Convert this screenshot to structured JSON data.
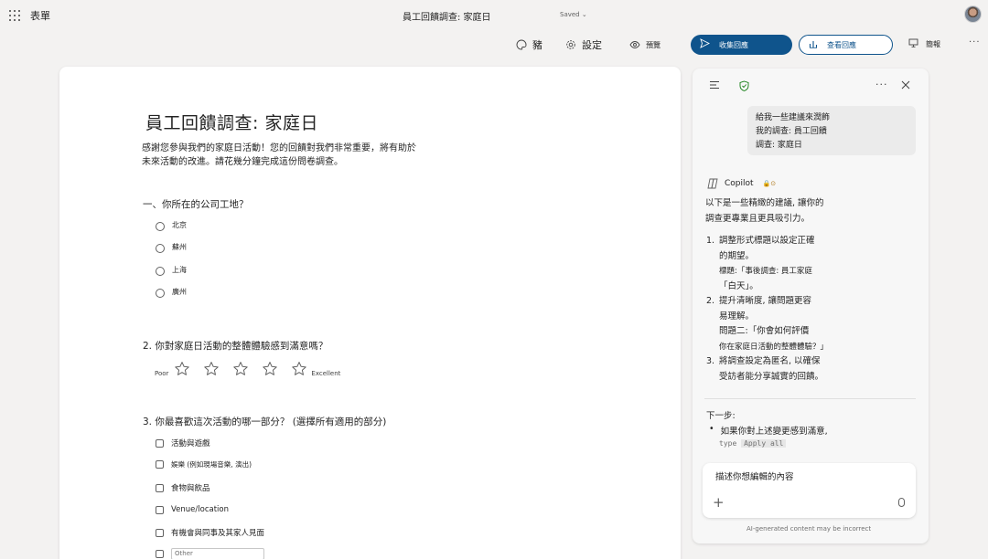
{
  "app": {
    "name": "表單",
    "doc_title": "員工回饋調查: 家庭日",
    "saved_status": "Saved"
  },
  "toolbar": {
    "style_label": "豬",
    "settings_label": "設定",
    "preview_label": "預覽",
    "collect_label": "收集回應",
    "responses_label": "查看回應",
    "present_label": "簡報"
  },
  "form": {
    "title": "員工回饋調查: 家庭日",
    "description_line1": "感謝您參與我們的家庭日活動！您的回饋對我們非常重要，將有助於",
    "description_line2": "未來活動的改進。請花幾分鐘完成這份問卷調查。",
    "q1": {
      "title": "一、你所在的公司工地？",
      "options": [
        "北京",
        "蘇州",
        "上海",
        "廣州"
      ]
    },
    "q2": {
      "title": "2. 你對家庭日活動的整體體驗感到滿意嗎？",
      "low_label": "Poor",
      "high_label": "Excellent",
      "star_count": 5
    },
    "q3": {
      "title": "3. 你最喜歡這次活動的哪一部分？ (選擇所有適用的部分)",
      "options": [
        "活動與遊戲",
        "娛樂 (例如現場音樂, 演出)",
        "食物與飲品",
        "Venue/location",
        "有機會與同事及其家人見面"
      ],
      "other_placeholder": "Other"
    }
  },
  "copilot": {
    "user_message_line1": "給我一些建議來潤飾",
    "user_message_line2": "我的調查: 員工回饋",
    "user_message_line3": "調查: 家庭日",
    "name": "Copilot",
    "intro_line1": "以下是一些精緻的建議, 讓你的",
    "intro_line2": "調查更專業且更具吸引力。",
    "items": [
      {
        "num": "1.",
        "lines": [
          "調整形式標題以設定正確",
          "的期望。",
          "標題:「事後調查: 員工家庭",
          "「白天」。"
        ]
      },
      {
        "num": "2.",
        "lines": [
          "提升清晰度, 讓問題更容",
          "易理解。",
          "問題二:「你會如何評價",
          "你在家庭日活動的整體體驗？」"
        ]
      },
      {
        "num": "3.",
        "lines": [
          "將調查設定為匿名, 以確保",
          "受訪者能分享誠實的回饋。"
        ]
      }
    ],
    "next_steps_label": "下一步:",
    "next_bullet": "如果你對上述變更感到滿意,",
    "code_prefix": "type",
    "code_text": "Apply all",
    "input_placeholder": "描述你想編輯的內容",
    "disclaimer": "AI-generated content may be incorrect"
  },
  "colors": {
    "primary": "#0f548c",
    "star_outline": "#616161"
  }
}
